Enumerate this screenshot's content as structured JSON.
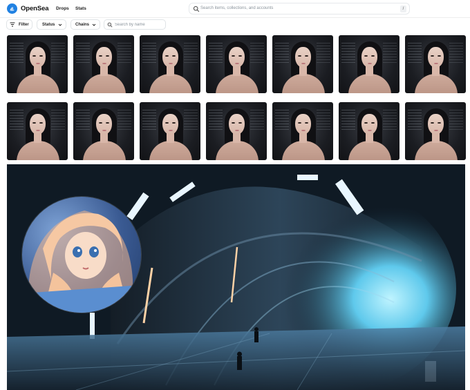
{
  "app": {
    "brand": "OpenSea",
    "nav": [
      {
        "label": "Drops"
      },
      {
        "label": "Stats"
      }
    ],
    "search": {
      "placeholder": "Search items, collections, and accounts",
      "shortcut": "/"
    },
    "icons": {
      "logo": "opensea-logo-icon",
      "search": "search-icon",
      "filter": "filter-icon",
      "chevron": "chevron-down-icon"
    },
    "colors": {
      "brand": "#2081e2",
      "border": "#e5e8eb",
      "placeholder": "#8a939b"
    }
  },
  "filters": {
    "filter_label": "Filter",
    "status_label": "Status",
    "chains_label": "Chains",
    "name_search_placeholder": "Search by name"
  },
  "grid": {
    "rows": 2,
    "columns": 7,
    "items": [
      {
        "subject": "portrait of a dark-haired woman"
      },
      {
        "subject": "portrait of a dark-haired woman"
      },
      {
        "subject": "portrait of a dark-haired woman"
      },
      {
        "subject": "portrait of a dark-haired woman"
      },
      {
        "subject": "portrait of a dark-haired woman"
      },
      {
        "subject": "portrait of a dark-haired woman"
      },
      {
        "subject": "portrait of a dark-haired woman"
      },
      {
        "subject": "portrait of a dark-haired woman"
      },
      {
        "subject": "portrait of a dark-haired woman"
      },
      {
        "subject": "portrait of a dark-haired woman"
      },
      {
        "subject": "portrait of a dark-haired woman"
      },
      {
        "subject": "portrait of a dark-haired woman"
      },
      {
        "subject": "portrait of a dark-haired woman"
      },
      {
        "subject": "portrait of a dark-haired woman"
      }
    ]
  },
  "banner": {
    "scene": "sci-fi hangar tunnel with glowing blue lights",
    "avatar": "anime girl portrait in circular frame"
  }
}
